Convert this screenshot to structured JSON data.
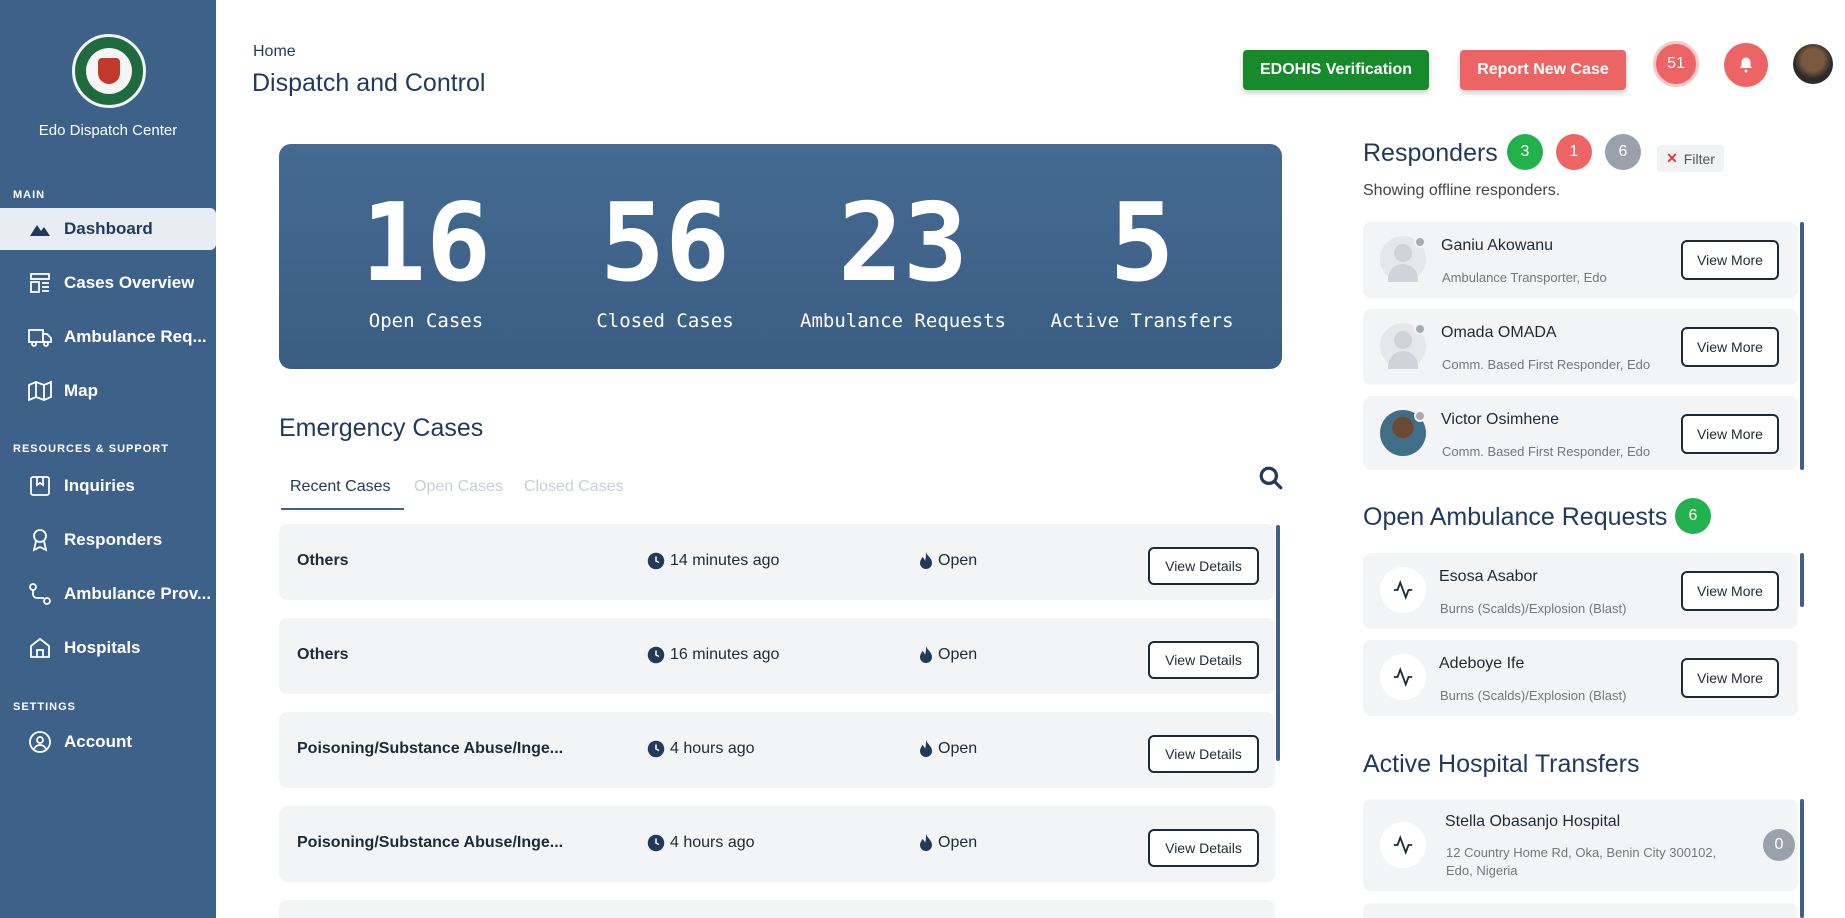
{
  "sidebar": {
    "brand": "Edo Dispatch Center",
    "sections": {
      "main": "MAIN",
      "resources": "RESOURCES & SUPPORT",
      "settings": "SETTINGS"
    },
    "items": [
      {
        "label": "Dashboard",
        "icon": "dashboard-icon"
      },
      {
        "label": "Cases Overview",
        "icon": "cases-icon"
      },
      {
        "label": "Ambulance Req...",
        "icon": "truck-icon"
      },
      {
        "label": "Map",
        "icon": "map-icon"
      },
      {
        "label": "Inquiries",
        "icon": "inquiries-icon"
      },
      {
        "label": "Responders",
        "icon": "award-icon"
      },
      {
        "label": "Ambulance Prov...",
        "icon": "route-icon"
      },
      {
        "label": "Hospitals",
        "icon": "home-icon"
      },
      {
        "label": "Account",
        "icon": "user-circle-icon"
      }
    ]
  },
  "header": {
    "breadcrumb": "Home",
    "title": "Dispatch and Control",
    "verify_label": "EDOHIS Verification",
    "report_label": "Report New Case",
    "notification_count": "51"
  },
  "stats": [
    {
      "value": "16",
      "label": "Open Cases"
    },
    {
      "value": "56",
      "label": "Closed Cases"
    },
    {
      "value": "23",
      "label": "Ambulance Requests"
    },
    {
      "value": "5",
      "label": "Active Transfers"
    }
  ],
  "emergency": {
    "title": "Emergency Cases",
    "tabs": [
      "Recent Cases",
      "Open Cases",
      "Closed Cases"
    ],
    "button_label": "View Details",
    "rows": [
      {
        "name": "Others",
        "time": "14 minutes ago",
        "status": "Open"
      },
      {
        "name": "Others",
        "time": "16 minutes ago",
        "status": "Open"
      },
      {
        "name": "Poisoning/Substance Abuse/Inge...",
        "time": "4 hours ago",
        "status": "Open"
      },
      {
        "name": "Poisoning/Substance Abuse/Inge...",
        "time": "4 hours ago",
        "status": "Open"
      }
    ]
  },
  "responders": {
    "title": "Responders",
    "counts": {
      "green": "3",
      "red": "1",
      "gray": "6"
    },
    "filter_label": "Filter",
    "subtitle": "Showing offline responders.",
    "button_label": "View More",
    "items": [
      {
        "name": "Ganiu Akowanu",
        "role": "Ambulance Transporter, Edo"
      },
      {
        "name": "Omada OMADA",
        "role": "Comm. Based First Responder, Edo"
      },
      {
        "name": "Victor Osimhene",
        "role": "Comm. Based First Responder, Edo"
      }
    ]
  },
  "ambulance": {
    "title": "Open Ambulance Requests",
    "count": "6",
    "button_label": "View More",
    "items": [
      {
        "name": "Esosa Asabor",
        "detail": "Burns (Scalds)/Explosion (Blast)"
      },
      {
        "name": "Adeboye Ife",
        "detail": "Burns (Scalds)/Explosion (Blast)"
      }
    ]
  },
  "transfers": {
    "title": "Active Hospital Transfers",
    "items": [
      {
        "name": "Stella Obasanjo Hospital",
        "address": "12 Country Home Rd, Oka, Benin City 300102, Edo, Nigeria",
        "count": "0"
      }
    ]
  },
  "colors": {
    "sidebar": "#3d6189",
    "accent_green": "#178a2b",
    "accent_red": "#ec6463",
    "gray": "#9aa1ab"
  }
}
